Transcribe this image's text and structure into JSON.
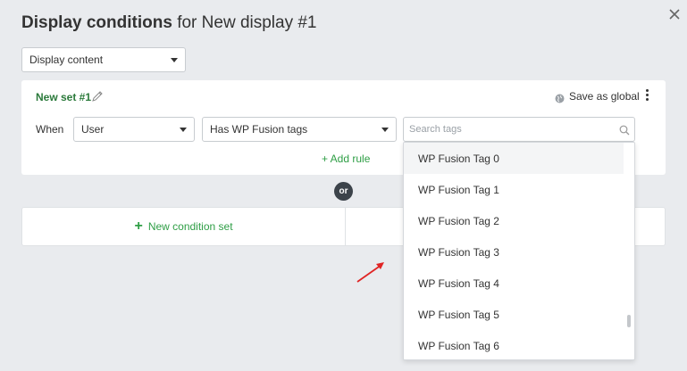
{
  "modal": {
    "title_strong": "Display conditions",
    "title_rest": " for New display #1"
  },
  "display_select": {
    "value": "Display content"
  },
  "condition_set": {
    "title": "New set #1",
    "save_global_label": "Save as global",
    "when_label": "When",
    "subject_select": "User",
    "operator_select": "Has WP Fusion tags",
    "search_placeholder": "Search tags",
    "add_rule_label": "+ Add rule"
  },
  "or_badge": "or",
  "new_condition_set_label": "New condition set",
  "dropdown": {
    "items": [
      "WP Fusion Tag 0",
      "WP Fusion Tag 1",
      "WP Fusion Tag 2",
      "WP Fusion Tag 3",
      "WP Fusion Tag 4",
      "WP Fusion Tag 5",
      "WP Fusion Tag 6"
    ]
  },
  "colors": {
    "accent_green": "#2e9e45",
    "title_green": "#2b7a3b",
    "annotation_arrow": "#e02424"
  }
}
